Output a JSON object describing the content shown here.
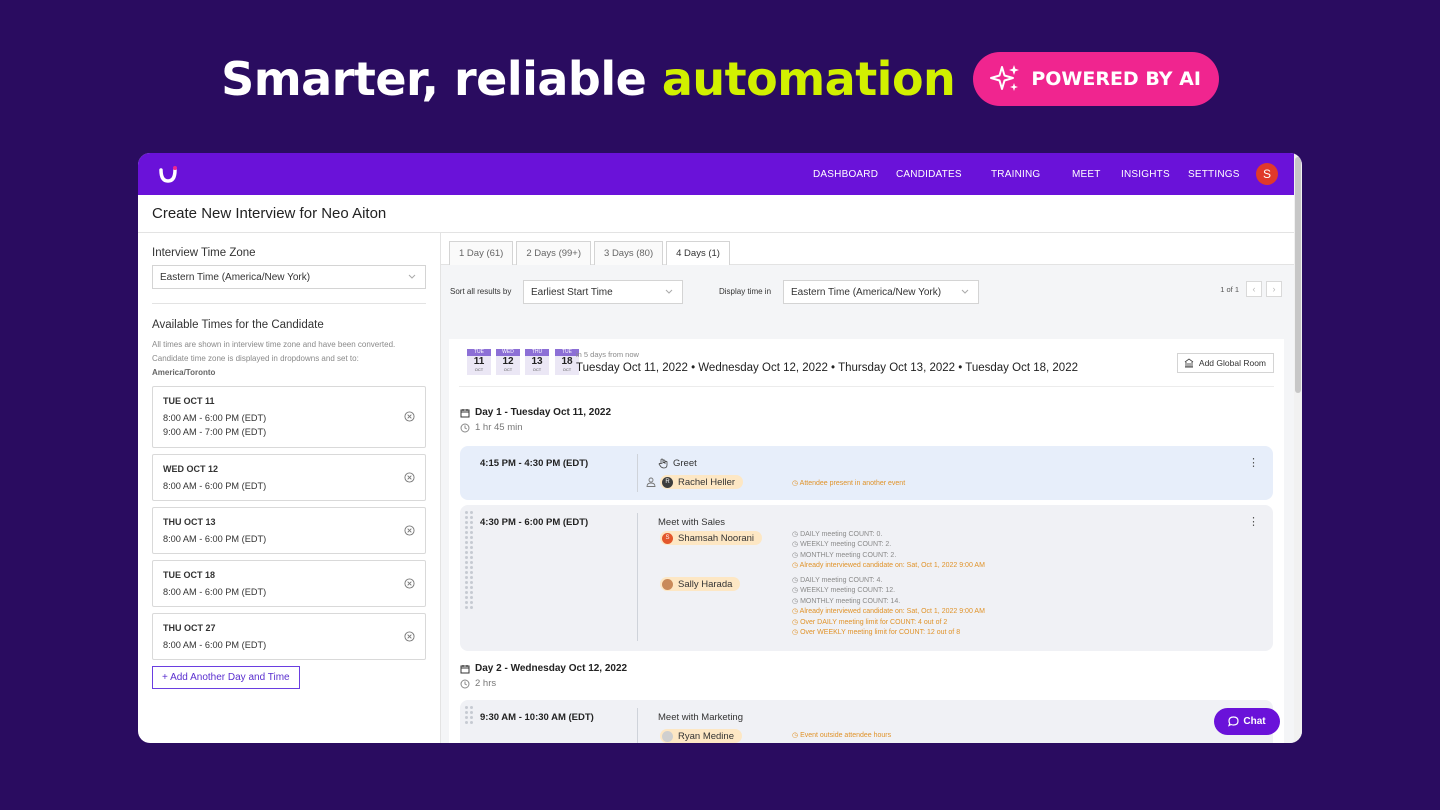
{
  "hero": {
    "title_main": "Smarter, reliable ",
    "title_accent": "automation",
    "pill_label": "POWERED BY AI"
  },
  "nav": {
    "items": [
      "DASHBOARD",
      "CANDIDATES",
      "TRAINING",
      "MEET",
      "INSIGHTS",
      "SETTINGS"
    ],
    "avatar_initial": "S"
  },
  "page": {
    "title": "Create New Interview for Neo Aiton"
  },
  "left": {
    "timezone_label": "Interview Time Zone",
    "timezone_value": "Eastern Time (America/New York)",
    "avail_title": "Available Times for the Candidate",
    "note_line1": "All times are shown in interview time zone and have been converted.",
    "note_line2": "Candidate time zone is displayed in dropdowns and set to:",
    "note_tz": "America/Toronto",
    "slots": [
      {
        "day": "TUE OCT 11",
        "t1": "8:00 AM - 6:00 PM (EDT)",
        "t2": "9:00 AM - 7:00 PM (EDT)"
      },
      {
        "day": "WED OCT 12",
        "t1": "8:00 AM - 6:00 PM (EDT)"
      },
      {
        "day": "THU OCT 13",
        "t1": "8:00 AM - 6:00 PM (EDT)"
      },
      {
        "day": "TUE OCT 18",
        "t1": "8:00 AM - 6:00 PM (EDT)"
      },
      {
        "day": "THU OCT 27",
        "t1": "8:00 AM - 6:00 PM (EDT)"
      }
    ],
    "add_label": "+ Add Another Day and Time"
  },
  "tabs": [
    "1 Day (61)",
    "2 Days (99+)",
    "3 Days (80)",
    "4 Days (1)"
  ],
  "sort": {
    "label": "Sort all results by",
    "value": "Earliest Start Time",
    "display_label": "Display time in",
    "display_value": "Eastern Time (America/New York)",
    "pager": "1 of 1"
  },
  "result": {
    "chips": [
      {
        "w": "TUE",
        "d": "11",
        "m": "OCT"
      },
      {
        "w": "WED",
        "d": "12",
        "m": "OCT"
      },
      {
        "w": "THU",
        "d": "13",
        "m": "OCT"
      },
      {
        "w": "TUE",
        "d": "18",
        "m": "OCT"
      }
    ],
    "in_days": "in 5 days from now",
    "dates": "Tuesday Oct 11, 2022 • Wednesday Oct 12, 2022 • Thursday Oct 13, 2022 • Tuesday Oct 18, 2022",
    "global_room": "Add Global Room"
  },
  "day1": {
    "title": "Day 1 - Tuesday Oct 11, 2022",
    "dur": "1 hr 45 min"
  },
  "ev1": {
    "time": "4:15 PM - 4:30 PM (EDT)",
    "title": "Greet",
    "person": "Rachel Heller",
    "person_initial": "R",
    "note": "Attendee present in another event"
  },
  "ev2": {
    "time": "4:30 PM - 6:00 PM (EDT)",
    "title": "Meet with Sales",
    "p1": "Shamsah Noorani",
    "p1_initial": "S",
    "p1_notes": [
      "DAILY meeting COUNT: 0.",
      "WEEKLY meeting COUNT: 2.",
      "MONTHLY meeting COUNT: 2.",
      "Already interviewed candidate on: Sat, Oct 1, 2022 9:00 AM"
    ],
    "p2": "Sally Harada",
    "p2_notes": [
      "DAILY meeting COUNT: 4.",
      "WEEKLY meeting COUNT: 12.",
      "MONTHLY meeting COUNT: 14.",
      "Already interviewed candidate on: Sat, Oct 1, 2022 9:00 AM",
      "Over DAILY meeting limit for COUNT: 4 out of 2",
      "Over WEEKLY meeting limit for COUNT: 12 out of 8"
    ]
  },
  "day2": {
    "title": "Day 2 - Wednesday Oct 12, 2022",
    "dur": "2 hrs"
  },
  "ev3": {
    "time": "9:30 AM - 10:30 AM (EDT)",
    "title": "Meet with Marketing",
    "person": "Ryan Medine",
    "note": "Event outside attendee hours"
  },
  "chat_label": "Chat",
  "colors": {
    "background": "#2a0c60",
    "nav": "#6a12d9",
    "accent": "#d2f000",
    "pill": "#f0258f",
    "warning": "#e0932a"
  }
}
